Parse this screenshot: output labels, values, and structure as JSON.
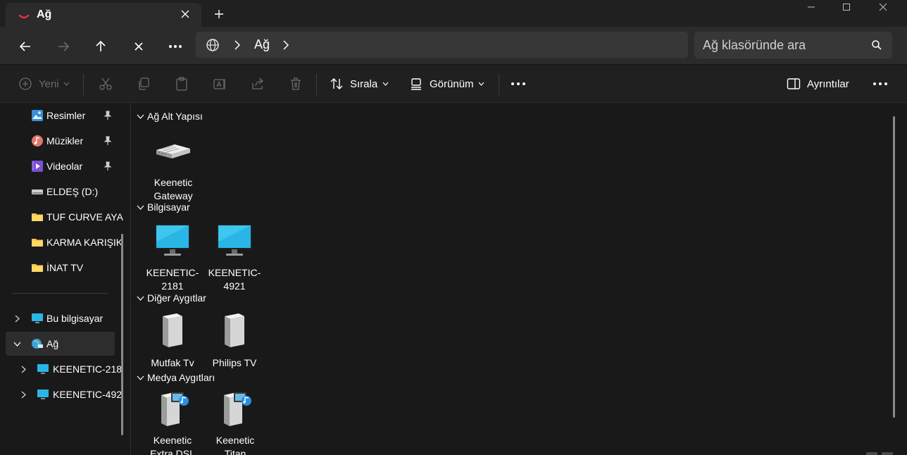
{
  "window": {
    "tab_title": "Ağ",
    "new_tab": "+"
  },
  "nav": {
    "address_crumb": "Ağ",
    "search_placeholder": "Ağ klasöründe ara"
  },
  "commands": {
    "new_label": "Yeni",
    "sort_label": "Sırala",
    "view_label": "Görünüm",
    "details_label": "Ayrıntılar"
  },
  "sidebar": {
    "items": [
      {
        "label": "Resimler",
        "icon": "pictures-icon",
        "pinned": true
      },
      {
        "label": "Müzikler",
        "icon": "music-icon",
        "pinned": true
      },
      {
        "label": "Videolar",
        "icon": "videos-icon",
        "pinned": true
      },
      {
        "label": "ELDEŞ (D:)",
        "icon": "drive-icon",
        "pinned": false
      },
      {
        "label": "TUF CURVE AYA",
        "icon": "folder-icon",
        "pinned": false
      },
      {
        "label": "KARMA KARIŞIK",
        "icon": "folder-icon",
        "pinned": false
      },
      {
        "label": "İNAT TV",
        "icon": "folder-icon",
        "pinned": false
      }
    ],
    "tree": [
      {
        "label": "Bu bilgisayar",
        "icon": "this-pc-icon"
      },
      {
        "label": "Ağ",
        "icon": "network-icon",
        "selected": true
      },
      {
        "label": "KEENETIC-218",
        "icon": "computer-icon"
      },
      {
        "label": "KEENETIC-492",
        "icon": "computer-icon"
      }
    ]
  },
  "groups": [
    {
      "title": "Ağ Alt Yapısı",
      "items": [
        {
          "line1": "Keenetic",
          "line2": "Gateway",
          "icon": "router-icon"
        }
      ]
    },
    {
      "title": "Bilgisayar",
      "items": [
        {
          "line1": "KEENETIC-",
          "line2": "2181",
          "icon": "monitor-icon"
        },
        {
          "line1": "KEENETIC-",
          "line2": "4921",
          "icon": "monitor-icon"
        }
      ]
    },
    {
      "title": "Diğer Aygıtlar",
      "items": [
        {
          "line1": "Mutfak Tv",
          "icon": "device-icon"
        },
        {
          "line1": "Philips TV",
          "icon": "device-icon"
        }
      ]
    },
    {
      "title": "Medya Aygıtları",
      "items": [
        {
          "line1": "Keenetic",
          "line2": "Extra DSL",
          "icon": "media-device-icon"
        },
        {
          "line1": "Keenetic",
          "line2": "Titan",
          "icon": "media-device-icon"
        }
      ]
    }
  ],
  "colors": {
    "background": "#191919",
    "toolbar": "#202020",
    "navbar": "#2b2b2b",
    "field": "#373737",
    "folder": "#f6c94c",
    "monitor": "#29b6e6"
  }
}
